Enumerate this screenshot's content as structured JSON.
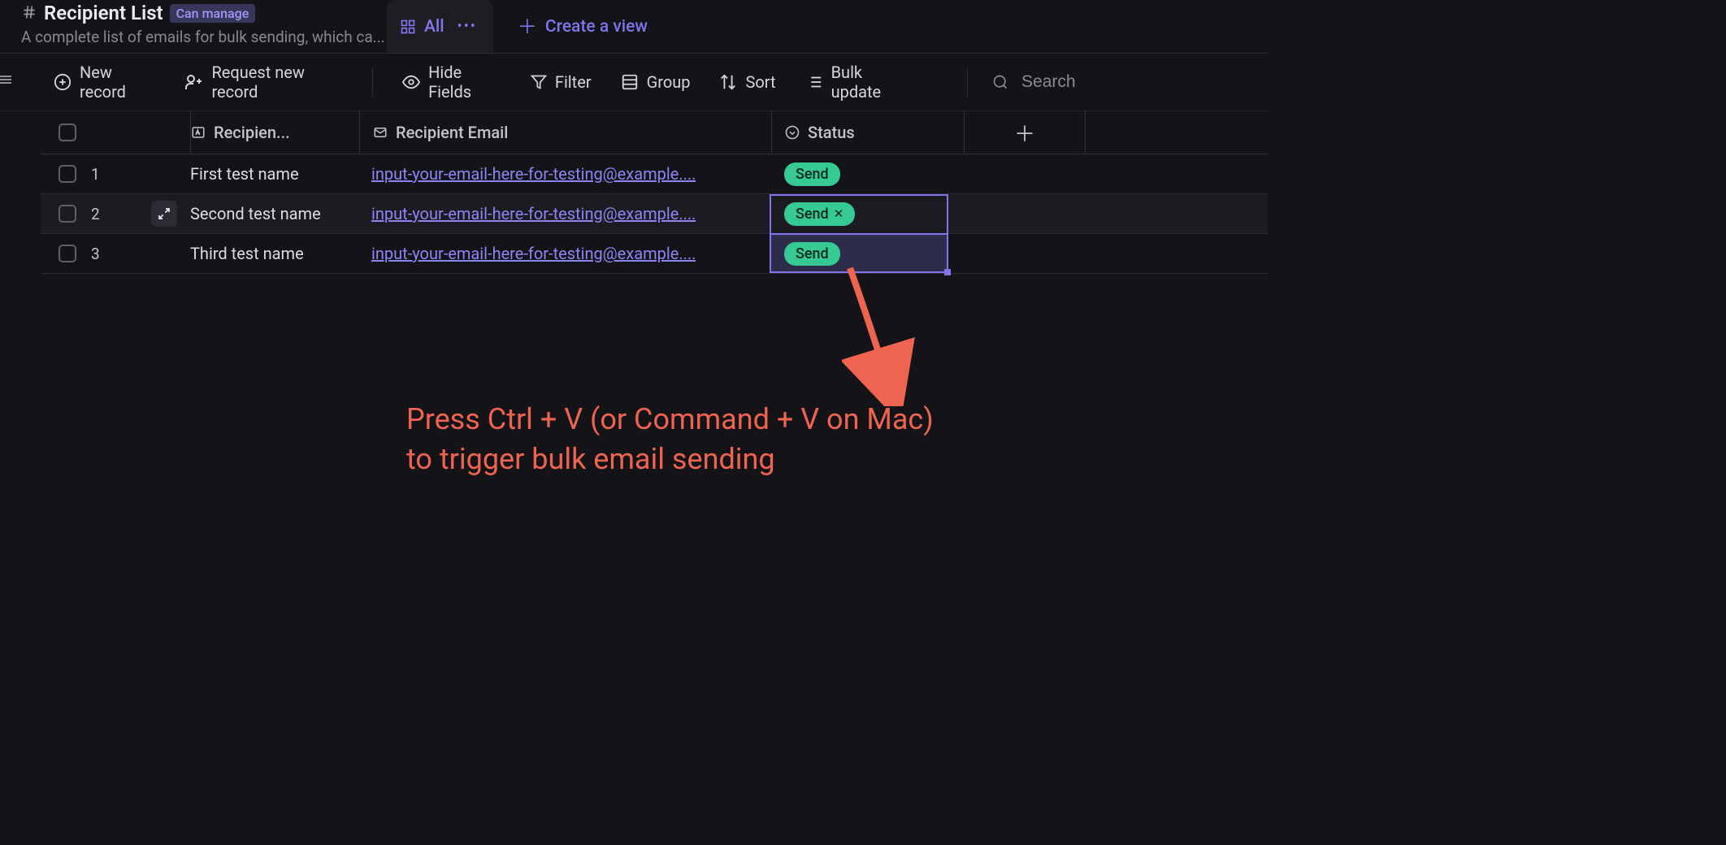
{
  "header": {
    "title": "Recipient List",
    "permission_badge": "Can manage",
    "subtitle": "A complete list of emails for bulk sending, which ca..."
  },
  "tabs": {
    "active_label": "All",
    "create_view_label": "Create a view"
  },
  "toolbar": {
    "new_record": "New record",
    "request_record": "Request new record",
    "hide_fields": "Hide Fields",
    "filter": "Filter",
    "group": "Group",
    "sort": "Sort",
    "bulk_update": "Bulk update",
    "search_placeholder": "Search"
  },
  "columns": {
    "name": "Recipien...",
    "email": "Recipient Email",
    "status": "Status"
  },
  "rows": [
    {
      "num": "1",
      "name": "First test name",
      "email": "input-your-email-here-for-testing@example....",
      "status": "Send"
    },
    {
      "num": "2",
      "name": "Second test name",
      "email": "input-your-email-here-for-testing@example....",
      "status": "Send"
    },
    {
      "num": "3",
      "name": "Third test name",
      "email": "input-your-email-here-for-testing@example....",
      "status": "Send"
    }
  ],
  "annotation": {
    "line1": "Press Ctrl + V (or Command + V on Mac)",
    "line2": "to trigger bulk email sending"
  }
}
